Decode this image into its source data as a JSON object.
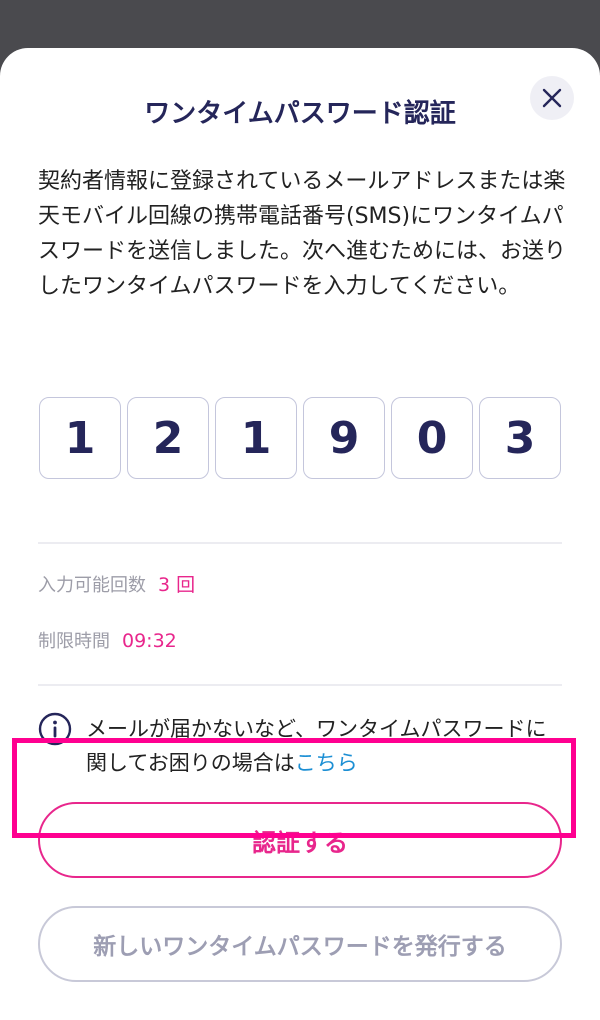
{
  "modal": {
    "title": "ワンタイムパスワード認証",
    "description": "契約者情報に登録されているメールアドレスまたは楽天モバイル回線の携帯電話番号(SMS)にワンタイムパスワードを送信しました。次へ進むためには、お送りしたワンタイムパスワードを入力してください。",
    "close_icon": "close-icon"
  },
  "otp": {
    "digits": [
      "1",
      "2",
      "1",
      "9",
      "0",
      "3"
    ]
  },
  "attempts": {
    "label": "入力可能回数",
    "value": "3 回"
  },
  "time_limit": {
    "label": "制限時間",
    "value": "09:32"
  },
  "notice": {
    "icon": "info-icon",
    "text": "メールが届かないなど、ワンタイムパスワードに関してお困りの場合は",
    "link": "こちら"
  },
  "buttons": {
    "verify": "認証する",
    "resend": "新しいワンタイムパスワードを発行する"
  },
  "colors": {
    "accent": "#e8268c",
    "title": "#25265a",
    "link": "#1c8fd4",
    "highlight": "#ff0090"
  }
}
